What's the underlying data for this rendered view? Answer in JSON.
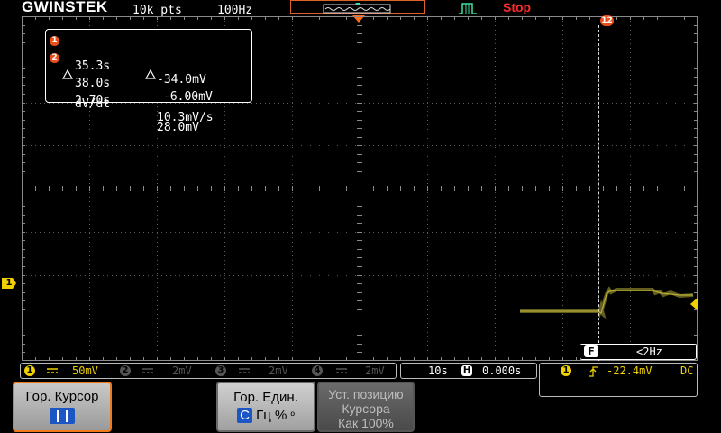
{
  "header": {
    "brand": "GWINSTEK",
    "record_length": "10k pts",
    "sample_rate": "100Hz",
    "run_state": "Stop",
    "run_state_color": "#ff2b2b"
  },
  "cursor_readout": {
    "cursor1_badge": "1",
    "cursor1_time": "35.3s",
    "cursor1_value": "-34.0mV",
    "cursor2_badge": "2",
    "cursor2_time": "38.0s",
    "cursor2_value": "-6.00mV",
    "delta_time": "2.70s",
    "delta_value": "28.0mV",
    "slope_label": "dV/dt",
    "slope_value": "10.3mV/s"
  },
  "cursor_tag": "12",
  "channel_marker": "1",
  "filter": {
    "badge": "F",
    "label": "<2Hz"
  },
  "channels": [
    {
      "num": "1",
      "coupling_icon": "dc-coupling-icon",
      "scale": "50mV",
      "color": "#f0d000",
      "active": true
    },
    {
      "num": "2",
      "coupling_icon": "dc-coupling-icon",
      "scale": "2mV",
      "color": "#555555",
      "active": false
    },
    {
      "num": "3",
      "coupling_icon": "dc-coupling-icon",
      "scale": "2mV",
      "color": "#555555",
      "active": false
    },
    {
      "num": "4",
      "coupling_icon": "dc-coupling-icon",
      "scale": "2mV",
      "color": "#555555",
      "active": false
    }
  ],
  "timebase": {
    "scale": "10s",
    "h_badge": "H",
    "position": "0.000s"
  },
  "trigger": {
    "source": "1",
    "edge_icon": "rising-edge-icon",
    "level": "-22.4mV",
    "coupling": "DC"
  },
  "softkeys": {
    "sk1_label": "Гор. Курсор",
    "sk2_label": "Гор. Един.",
    "sk2_opt_c": "С",
    "sk2_opt_hz": "Гц",
    "sk2_opt_pct": "%",
    "sk2_opt_deg": "º",
    "sk3_line1": "Уст. позицию",
    "sk3_line2": "Курсора",
    "sk3_line3": "Как 100%"
  }
}
